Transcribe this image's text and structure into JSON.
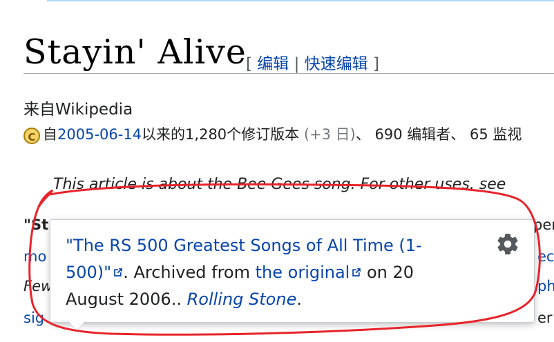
{
  "article": {
    "title": "Stayin' Alive",
    "edit_open": "[ ",
    "edit_label": "编辑",
    "edit_sep": " | ",
    "quick_edit_label": "快速编辑",
    "edit_close": " ]",
    "from_line": "来自Wikipedia",
    "info": {
      "prefix": "自",
      "date": "2005-06-14",
      "revisions": "以来的1,280个修订版本 ",
      "recent": "(+3 日)",
      "rest": "、 690 编辑者、 65 监视"
    },
    "hatnote": "This article is about the Bee Gees song. For other uses, see",
    "bg_fragments": {
      "bold_start": "\"St",
      "left_line2": "mo",
      "left_line3": "Few",
      "left_line4": "sig",
      "right_line1": "per",
      "right_line2": "ec",
      "right_line3": "ph",
      "right_line4": "er"
    }
  },
  "popup": {
    "link_title": "\"The RS 500 Greatest Songs of All Time (1-500)\"",
    "text_archived": ". Archived from ",
    "link_original": "the original",
    "text_date": " on 20 August 2006.. ",
    "publisher": "Rolling Stone",
    "end": ".",
    "settings_icon": "gear-icon"
  },
  "colors": {
    "link": "#0645ad",
    "annotation": "#e8232a"
  }
}
